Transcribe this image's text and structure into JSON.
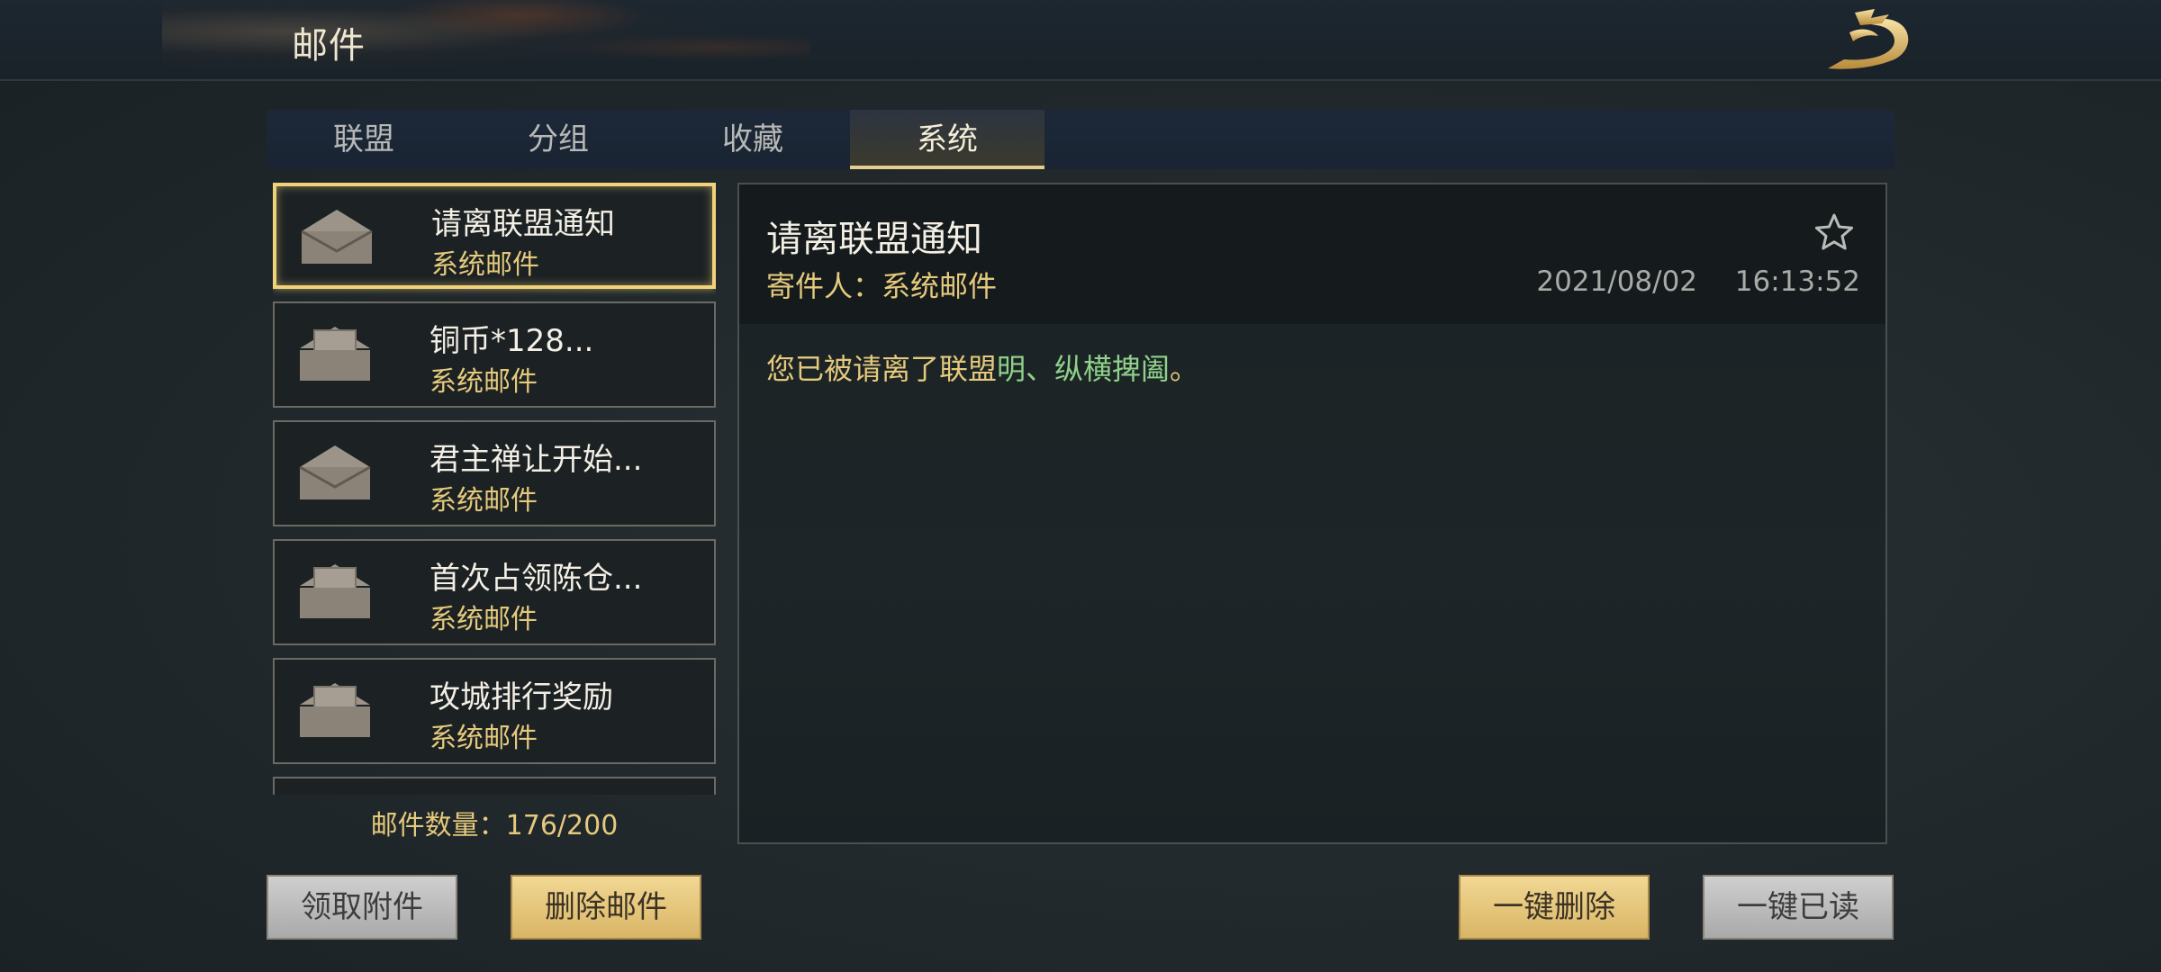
{
  "header": {
    "title": "邮件"
  },
  "tabs": [
    {
      "label": "联盟",
      "active": false
    },
    {
      "label": "分组",
      "active": false
    },
    {
      "label": "收藏",
      "active": false
    },
    {
      "label": "系统",
      "active": true
    }
  ],
  "mail_list": [
    {
      "title": "请离联盟通知",
      "type": "系统邮件",
      "icon": "envelope-open-icon",
      "selected": true
    },
    {
      "title": "铜币*128...",
      "type": "系统邮件",
      "icon": "envelope-with-letter-icon",
      "selected": false
    },
    {
      "title": "君主禅让开始...",
      "type": "系统邮件",
      "icon": "envelope-open-icon",
      "selected": false
    },
    {
      "title": "首次占领陈仓...",
      "type": "系统邮件",
      "icon": "envelope-with-letter-icon",
      "selected": false
    },
    {
      "title": "攻城排行奖励",
      "type": "系统邮件",
      "icon": "envelope-with-letter-icon",
      "selected": false
    }
  ],
  "mail_count": "邮件数量：176/200",
  "detail": {
    "subject": "请离联盟通知",
    "sender": "寄件人：系统邮件",
    "date": "2021/08/02",
    "time": "16:13:52",
    "body_prefix": "您已被请离了联盟",
    "body_highlight": "明、纵横捭阖",
    "body_suffix": "。"
  },
  "buttons": {
    "claim_attachments": "领取附件",
    "delete_mail": "删除邮件",
    "delete_all": "一键删除",
    "read_all": "一键已读"
  },
  "colors": {
    "gold_text": "#e5c97c",
    "highlight_green": "#8fd18a",
    "selected_border": "#f0d27a"
  }
}
